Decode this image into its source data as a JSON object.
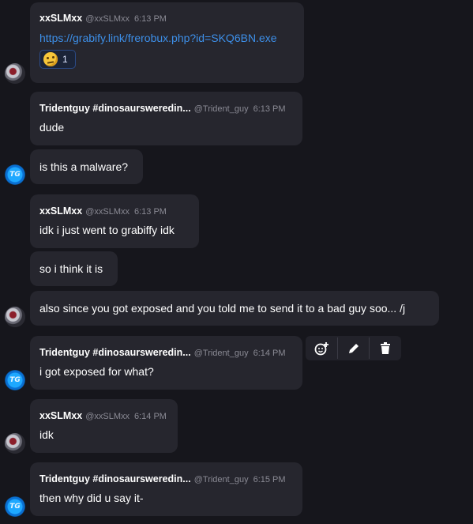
{
  "messages": [
    {
      "user": "xxSLMxx",
      "handle": "@xxSLMxx",
      "time": "6:13 PM",
      "text": "https://grabify.link/frerobux.php?id=SKQ6BN.exe",
      "reaction_count": "1"
    },
    {
      "user": "Tridentguy #dinosaursweredin...",
      "handle": "@Trident_guy",
      "time": "6:13 PM",
      "text": "dude"
    },
    {
      "text": "is this a malware?"
    },
    {
      "user": "xxSLMxx",
      "handle": "@xxSLMxx",
      "time": "6:13 PM",
      "text": "idk i just went to grabiffy idk"
    },
    {
      "text": "so i think it is"
    },
    {
      "text": "also since you got exposed and you told me to send it to a bad guy soo... /j"
    },
    {
      "user": "Tridentguy #dinosaursweredin...",
      "handle": "@Trident_guy",
      "time": "6:14 PM",
      "text": "i got exposed for what?"
    },
    {
      "user": "xxSLMxx",
      "handle": "@xxSLMxx",
      "time": "6:14 PM",
      "text": "idk"
    },
    {
      "user": "Tridentguy #dinosaursweredin...",
      "handle": "@Trident_guy",
      "time": "6:15 PM",
      "text": "then why did u say it-"
    }
  ],
  "avatars": {
    "trident_initials": "TG"
  },
  "toolbar": {
    "add_reaction": "add-reaction-icon",
    "edit": "pencil-icon",
    "delete": "trash-icon"
  },
  "colors": {
    "background": "#16161c",
    "bubble": "#26262e",
    "link": "#3d8fe8",
    "muted": "#8a8a94"
  }
}
